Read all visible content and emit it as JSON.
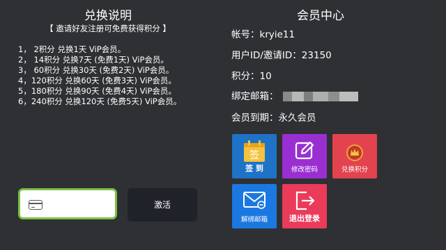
{
  "left": {
    "title": "兑换说明",
    "subtitle": "【 邀请好友注册可免费获得积分 】",
    "rules": [
      "1， 2积分 兑换1天 ViP会员。",
      "2， 14积分 兑换7天 (免费1天) ViP会员。",
      "3， 60积分 兑换30天 (免费2天) ViP会员。",
      "4，120积分 兑换60天 (免费3天) ViP会员。",
      "5，180积分 兑换90天 (免费4天) ViP会员。",
      "6，240积分 兑换120天 (免费5天) ViP会员。"
    ],
    "code_input": {
      "value": "",
      "placeholder": ""
    },
    "activate_label": "激活"
  },
  "right": {
    "title": "会员中心",
    "account": "帐号：kryie11",
    "user_id": "用户ID/邀请ID：23150",
    "points": "积分：10",
    "email_label": "绑定邮箱：",
    "expiry": "会员到期：永久会员",
    "tiles": [
      {
        "label": "签 到",
        "icon": "calendar-sign-icon",
        "color": "#1f73c7"
      },
      {
        "label": "修改密码",
        "icon": "edit-icon",
        "color": "#9a2fd1"
      },
      {
        "label": "兑换积分",
        "icon": "crown-badge-icon",
        "color": "#e2434f"
      },
      {
        "label": "解绑邮箱",
        "icon": "mail-icon",
        "color": "#1c78e1"
      },
      {
        "label": "退出登录",
        "icon": "logout-icon",
        "color": "#ea3b5a"
      }
    ],
    "calendar_text": "签"
  }
}
